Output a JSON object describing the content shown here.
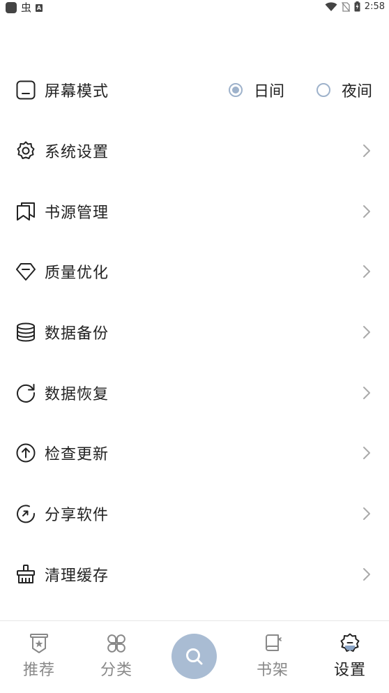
{
  "status_bar": {
    "time": "2:58",
    "app_glyph": "虫",
    "notif_badge": "A"
  },
  "screen_mode": {
    "label": "屏幕模式",
    "options": [
      {
        "label": "日间",
        "selected": true
      },
      {
        "label": "夜间",
        "selected": false
      }
    ]
  },
  "menu": {
    "items": [
      {
        "label": "系统设置",
        "icon": "gear-icon"
      },
      {
        "label": "书源管理",
        "icon": "bookmark-icon"
      },
      {
        "label": "质量优化",
        "icon": "diamond-icon"
      },
      {
        "label": "数据备份",
        "icon": "database-icon"
      },
      {
        "label": "数据恢复",
        "icon": "refresh-icon"
      },
      {
        "label": "检查更新",
        "icon": "arrow-up-circle-icon"
      },
      {
        "label": "分享软件",
        "icon": "share-rotate-icon"
      },
      {
        "label": "清理缓存",
        "icon": "broom-icon"
      }
    ]
  },
  "bottom_nav": {
    "tabs": [
      {
        "label": "推荐",
        "icon": "recommend-badge-icon",
        "active": false
      },
      {
        "label": "分类",
        "icon": "category-icon",
        "active": false
      },
      {
        "label": "书架",
        "icon": "bookshelf-icon",
        "active": false
      },
      {
        "label": "设置",
        "icon": "settings-gear-icon",
        "active": true
      }
    ],
    "search_icon": "search-icon"
  },
  "colors": {
    "accent": "#a9bcd3",
    "radio": "#9eb2cb",
    "text": "#222222",
    "muted": "#888888"
  }
}
